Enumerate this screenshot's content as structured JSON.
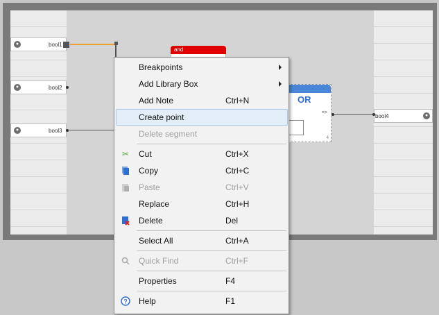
{
  "canvas": {
    "vars_left": [
      {
        "name": "bool1"
      },
      {
        "name": "bool2"
      },
      {
        "name": "bool3"
      }
    ],
    "vars_right": [
      {
        "name": "bool4"
      }
    ],
    "and_block": {
      "label": "and"
    },
    "or_block": {
      "title": "OR",
      "output_label": "=>",
      "index": "4"
    }
  },
  "menu": {
    "breakpoints": "Breakpoints",
    "add_library_box": "Add Library Box",
    "add_note": "Add Note",
    "add_note_sc": "Ctrl+N",
    "create_point": "Create point",
    "delete_segment": "Delete segment",
    "cut": "Cut",
    "cut_sc": "Ctrl+X",
    "copy": "Copy",
    "copy_sc": "Ctrl+C",
    "paste": "Paste",
    "paste_sc": "Ctrl+V",
    "replace": "Replace",
    "replace_sc": "Ctrl+H",
    "delete": "Delete",
    "delete_sc": "Del",
    "select_all": "Select All",
    "select_all_sc": "Ctrl+A",
    "quick_find": "Quick Find",
    "quick_find_sc": "Ctrl+F",
    "properties": "Properties",
    "properties_sc": "F4",
    "help": "Help",
    "help_sc": "F1"
  },
  "icons": {
    "cut": "scissors-icon",
    "copy": "copy-icon",
    "paste": "paste-icon",
    "delete": "delete-icon",
    "quick_find": "quick-find-icon",
    "help": "help-icon"
  },
  "colors": {
    "and_header": "#e00000",
    "or_header": "#4a86d8",
    "highlight": "#e3eef9",
    "selected_wire": "#f0a030"
  }
}
